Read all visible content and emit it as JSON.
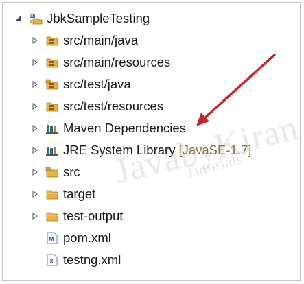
{
  "tree": {
    "project": {
      "label": "JbkSampleTesting",
      "icon": "maven-project-icon"
    },
    "items": [
      {
        "label": "src/main/java",
        "icon": "package-folder-icon"
      },
      {
        "label": "src/main/resources",
        "icon": "package-folder-icon"
      },
      {
        "label": "src/test/java",
        "icon": "package-folder-test-icon"
      },
      {
        "label": "src/test/resources",
        "icon": "package-folder-icon"
      },
      {
        "label": "Maven Dependencies",
        "icon": "library-icon"
      },
      {
        "label": "JRE System Library",
        "suffix": "[JavaSE-1.7]",
        "icon": "library-icon"
      },
      {
        "label": "src",
        "icon": "folder-source-icon"
      },
      {
        "label": "target",
        "icon": "folder-icon"
      },
      {
        "label": "test-output",
        "icon": "folder-icon"
      },
      {
        "label": "pom.xml",
        "icon": "maven-file-icon",
        "badge": "M"
      },
      {
        "label": "testng.xml",
        "icon": "xml-file-icon",
        "badge": "X"
      }
    ]
  },
  "watermark": {
    "line1": "JavabyKiran",
    "line2": "Tutorials"
  },
  "colors": {
    "arrow": "#c1272d",
    "folder": "#e8b24a",
    "library": "#3b7a3b",
    "suffix": "#8a6d3b"
  }
}
